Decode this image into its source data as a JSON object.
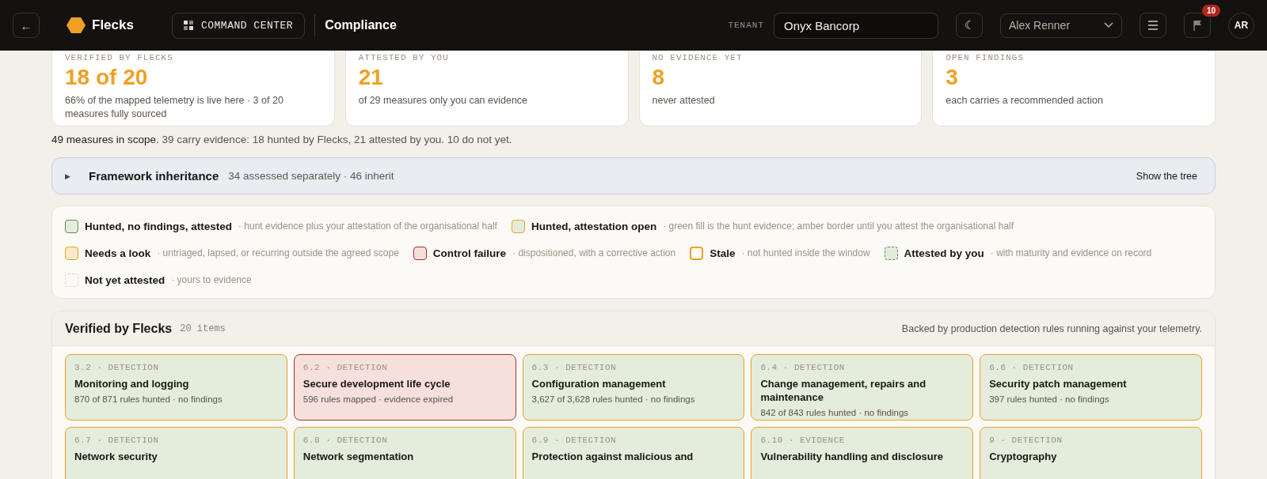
{
  "header": {
    "back": "←",
    "brand": "Flecks",
    "command_center": "COMMAND CENTER",
    "page_title": "Compliance",
    "tenant_label": "TENANT",
    "tenant_value": "Onyx Bancorp",
    "theme_toggle": "☾",
    "user_select": "Alex Renner",
    "notifications_count": "10",
    "avatar": "AR"
  },
  "stats": [
    {
      "label": "VERIFIED BY FLECKS",
      "value": "18 of 20",
      "note": "66% of the mapped telemetry is live here · 3 of 20 measures fully sourced"
    },
    {
      "label": "ATTESTED BY YOU",
      "value": "21",
      "note": "of 29 measures only you can evidence"
    },
    {
      "label": "NO EVIDENCE YET",
      "value": "8",
      "note": "never attested"
    },
    {
      "label": "OPEN FINDINGS",
      "value": "3",
      "note": "each carries a recommended action"
    }
  ],
  "summary": "**49 measures in scope.** 39 carry evidence: 18 hunted by Flecks, 21 attested by you. 10 do not yet.",
  "inheritance": {
    "caret": "▶",
    "expanded": false,
    "title": "Framework inheritance",
    "detail": "34 assessed separately · 46 inherit",
    "action": "Show the tree"
  },
  "legend": [
    {
      "kind": "hunted-attested",
      "label": "Hunted, no findings, attested",
      "note": "· hunt evidence plus your attestation of the organisational half"
    },
    {
      "kind": "hunted-open",
      "label": "Hunted, attestation open",
      "note": "· green fill is the hunt evidence; amber border until you attest the organisational half"
    },
    {
      "kind": "needs-look",
      "label": "Needs a look",
      "note": "· untriaged, lapsed, or recurring outside the agreed scope"
    },
    {
      "kind": "failure",
      "label": "Control failure",
      "note": "· dispositioned, with a corrective action"
    },
    {
      "kind": "stale",
      "label": "Stale",
      "note": "· not hunted inside the window"
    },
    {
      "kind": "attested",
      "label": "Attested by you",
      "note": "· with maturity and evidence on record"
    },
    {
      "kind": "not-attested",
      "label": "Not yet attested",
      "note": "· yours to evidence"
    }
  ],
  "verified": {
    "title": "Verified by Flecks",
    "count": "20 items",
    "note": "Backed by production detection rules running against your telemetry.",
    "controls": [
      {
        "kind": "hunted-open",
        "ref": "3.2 · DETECTION",
        "title": "Monitoring and logging",
        "detail": "870 of 871 rules hunted · no findings"
      },
      {
        "kind": "failure",
        "ref": "6.2 · DETECTION",
        "title": "Secure development life cycle",
        "detail": "596 rules mapped · evidence expired"
      },
      {
        "kind": "hunted-open",
        "ref": "6.3 · DETECTION",
        "title": "Configuration management",
        "detail": "3,627 of 3,628 rules hunted · no findings"
      },
      {
        "kind": "hunted-open",
        "ref": "6.4 · DETECTION",
        "title": "Change management, repairs and maintenance",
        "detail": "842 of 843 rules hunted · no findings"
      },
      {
        "kind": "hunted-open",
        "ref": "6.6 · DETECTION",
        "title": "Security patch management",
        "detail": "397 rules hunted · no findings"
      },
      {
        "kind": "hunted-open",
        "ref": "6.7 · DETECTION",
        "title": "Network security"
      },
      {
        "kind": "hunted-open",
        "ref": "6.8 · DETECTION",
        "title": "Network segmentation"
      },
      {
        "kind": "hunted-open",
        "ref": "6.9 · DETECTION",
        "title": "Protection against malicious and"
      },
      {
        "kind": "hunted-open",
        "ref": "6.10 · EVIDENCE",
        "title": "Vulnerability handling and disclosure"
      },
      {
        "kind": "hunted-open",
        "ref": "9 · DETECTION",
        "title": "Cryptography"
      }
    ]
  }
}
